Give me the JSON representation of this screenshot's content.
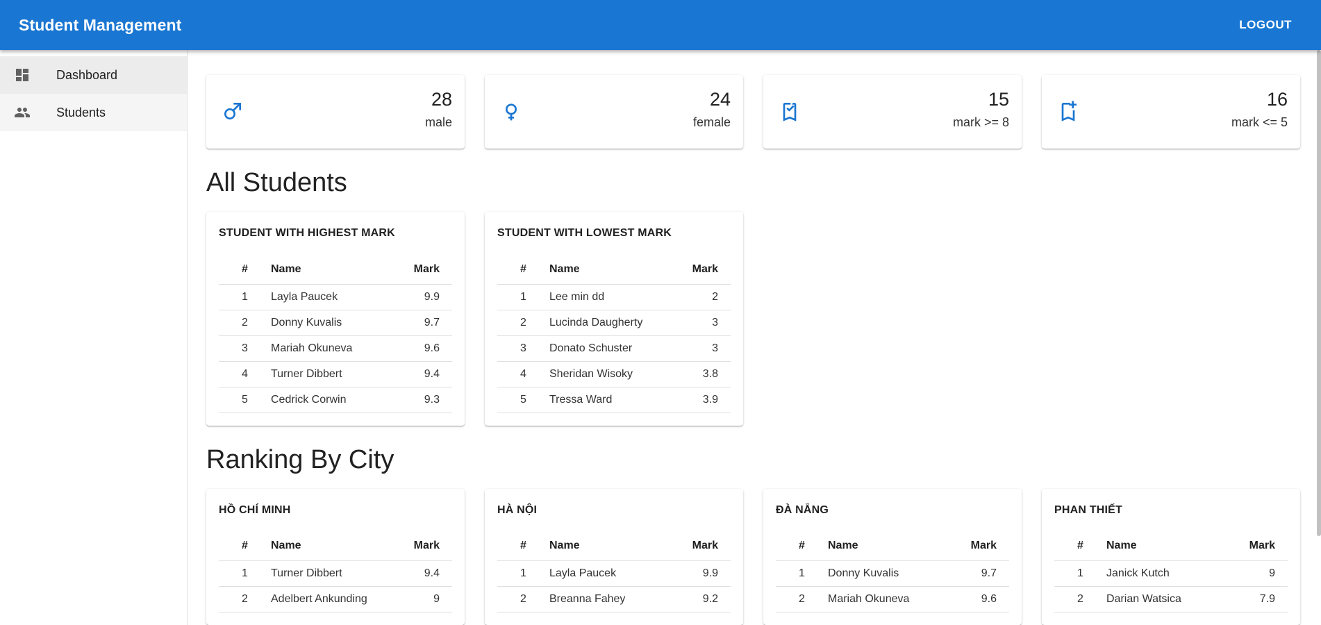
{
  "appbar": {
    "title": "Student Management",
    "logout_label": "LOGOUT"
  },
  "sidebar": {
    "items": [
      {
        "label": "Dashboard",
        "icon": "dashboard-icon"
      },
      {
        "label": "Students",
        "icon": "people-icon"
      }
    ]
  },
  "stats": [
    {
      "value": "28",
      "label": "male",
      "icon": "male-icon"
    },
    {
      "value": "24",
      "label": "female",
      "icon": "female-icon"
    },
    {
      "value": "15",
      "label": "mark >= 8",
      "icon": "bookmark-check-icon"
    },
    {
      "value": "16",
      "label": "mark <= 5",
      "icon": "bookmark-plus-icon"
    }
  ],
  "colors": {
    "primary": "#1976d2"
  },
  "sections": {
    "all_students": "All Students",
    "ranking_by_city": "Ranking By City"
  },
  "columns": {
    "index": "#",
    "name": "Name",
    "mark": "Mark"
  },
  "highest": {
    "title": "STUDENT WITH HIGHEST MARK",
    "rows": [
      {
        "idx": "1",
        "name": "Layla Paucek",
        "mark": "9.9"
      },
      {
        "idx": "2",
        "name": "Donny Kuvalis",
        "mark": "9.7"
      },
      {
        "idx": "3",
        "name": "Mariah Okuneva",
        "mark": "9.6"
      },
      {
        "idx": "4",
        "name": "Turner Dibbert",
        "mark": "9.4"
      },
      {
        "idx": "5",
        "name": "Cedrick Corwin",
        "mark": "9.3"
      }
    ]
  },
  "lowest": {
    "title": "STUDENT WITH LOWEST MARK",
    "rows": [
      {
        "idx": "1",
        "name": "Lee min dd",
        "mark": "2"
      },
      {
        "idx": "2",
        "name": "Lucinda Daugherty",
        "mark": "3"
      },
      {
        "idx": "3",
        "name": "Donato Schuster",
        "mark": "3"
      },
      {
        "idx": "4",
        "name": "Sheridan Wisoky",
        "mark": "3.8"
      },
      {
        "idx": "5",
        "name": "Tressa Ward",
        "mark": "3.9"
      }
    ]
  },
  "cities": [
    {
      "title": "HỒ CHÍ MINH",
      "rows": [
        {
          "idx": "1",
          "name": "Turner Dibbert",
          "mark": "9.4"
        },
        {
          "idx": "2",
          "name": "Adelbert Ankunding",
          "mark": "9"
        }
      ]
    },
    {
      "title": "HÀ NỘI",
      "rows": [
        {
          "idx": "1",
          "name": "Layla Paucek",
          "mark": "9.9"
        },
        {
          "idx": "2",
          "name": "Breanna Fahey",
          "mark": "9.2"
        }
      ]
    },
    {
      "title": "ĐÀ NẴNG",
      "rows": [
        {
          "idx": "1",
          "name": "Donny Kuvalis",
          "mark": "9.7"
        },
        {
          "idx": "2",
          "name": "Mariah Okuneva",
          "mark": "9.6"
        }
      ]
    },
    {
      "title": "PHAN THIẾT",
      "rows": [
        {
          "idx": "1",
          "name": "Janick Kutch",
          "mark": "9"
        },
        {
          "idx": "2",
          "name": "Darian Watsica",
          "mark": "7.9"
        }
      ]
    }
  ]
}
